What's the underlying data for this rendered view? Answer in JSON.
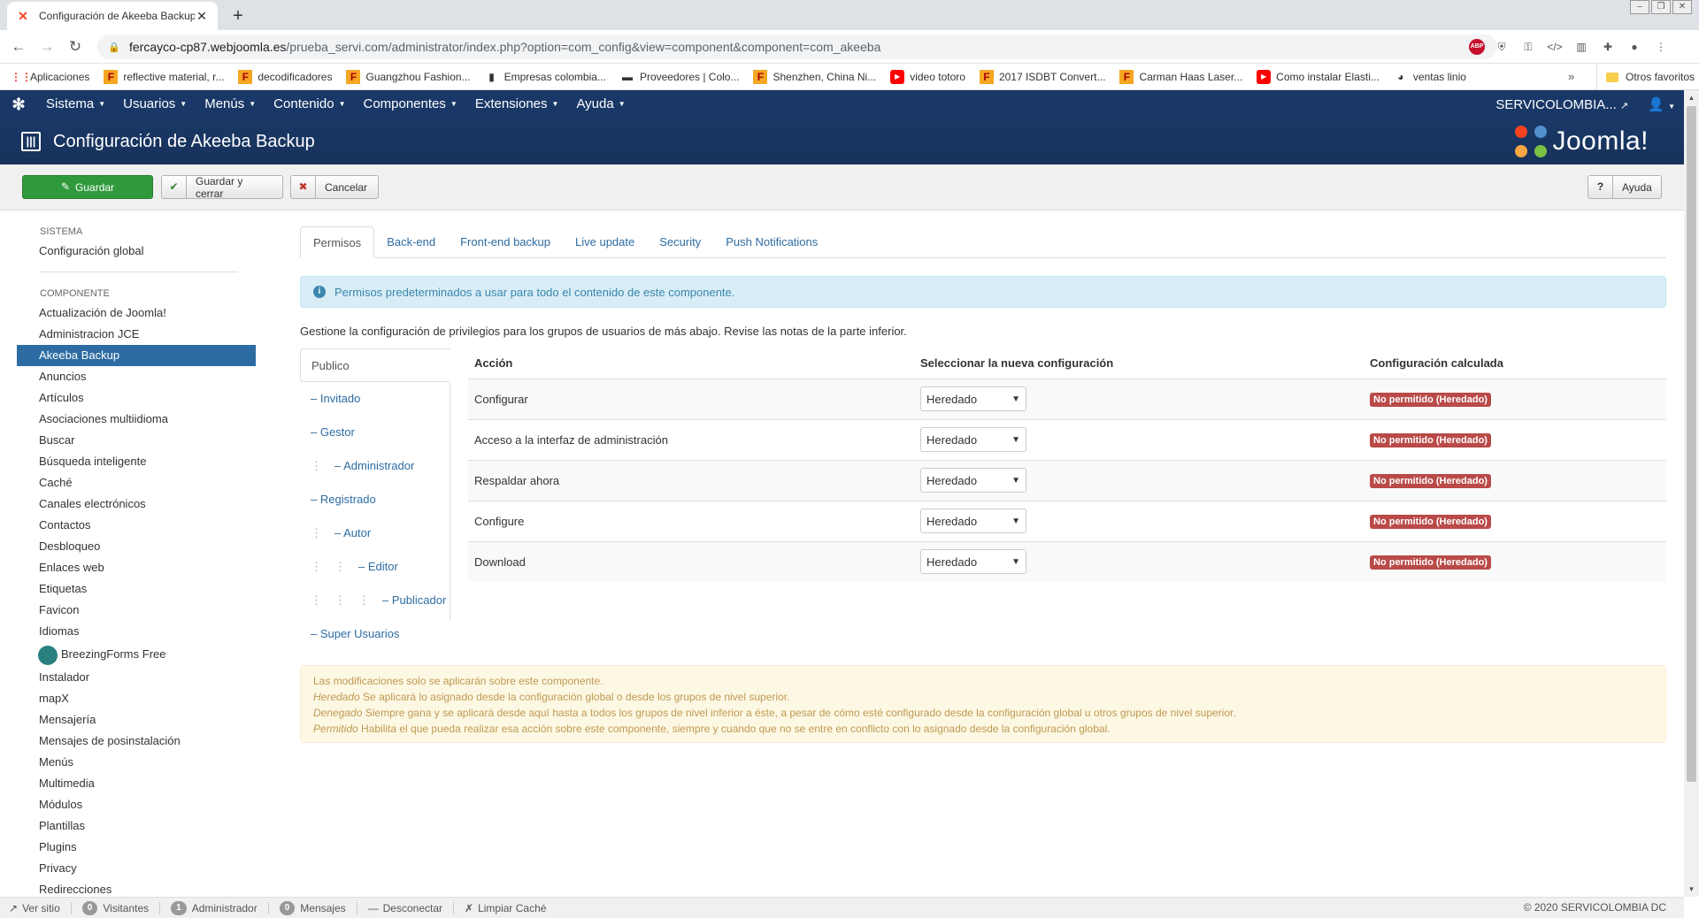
{
  "browser": {
    "tab_title": "Configuración de Akeeba Backup",
    "url_host": "fercayco-cp87.webjoomla.es",
    "url_path": "/prueba_servi.com/administrator/index.php?option=com_config&view=component&component=com_akeeba",
    "bookmarks": [
      {
        "icon": "apps-icon",
        "label": "Aplicaciones"
      },
      {
        "icon": "aliexpress-icon",
        "label": "reflective material, r..."
      },
      {
        "icon": "aliexpress-icon",
        "label": "decodificadores"
      },
      {
        "icon": "aliexpress-icon",
        "label": "Guangzhou Fashion..."
      },
      {
        "icon": "page-icon",
        "label": "Empresas colombia..."
      },
      {
        "icon": "truck-icon",
        "label": "Proveedores | Colo..."
      },
      {
        "icon": "aliexpress-icon",
        "label": "Shenzhen, China Ni..."
      },
      {
        "icon": "youtube-icon",
        "label": "video totoro"
      },
      {
        "icon": "aliexpress-icon",
        "label": "2017 ISDBT Convert..."
      },
      {
        "icon": "aliexpress-icon",
        "label": "Carman Haas Laser..."
      },
      {
        "icon": "youtube-icon",
        "label": "Como instalar Elasti..."
      },
      {
        "icon": "globe-icon",
        "label": "ventas linio"
      }
    ],
    "bookmarks_more": "»",
    "other_bookmarks": "Otros favoritos"
  },
  "navbar": {
    "menu": [
      "Sistema",
      "Usuarios",
      "Menús",
      "Contenido",
      "Componentes",
      "Extensiones",
      "Ayuda"
    ],
    "site_name": "SERVICOLOMBIA..."
  },
  "header": {
    "title": "Configuración de Akeeba Backup",
    "brand": "Joomla!"
  },
  "toolbar": {
    "save": "Guardar",
    "save_close": "Guardar y cerrar",
    "cancel": "Cancelar",
    "help": "Ayuda"
  },
  "sidebar": {
    "system_heading": "Sistema",
    "system_items": [
      "Configuración global"
    ],
    "component_heading": "Componente",
    "component_items": [
      "Actualización de Joomla!",
      "Administracion JCE",
      "Akeeba Backup",
      "Anuncios",
      "Artículos",
      "Asociaciones multiidioma",
      "Buscar",
      "Búsqueda inteligente",
      "Caché",
      "Canales electrónicos",
      "Contactos",
      "Desbloqueo",
      "Enlaces web",
      "Etiquetas",
      "Favicon",
      "Idiomas",
      "BreezingForms Free",
      "Instalador",
      "mapX",
      "Mensajería",
      "Mensajes de posinstalación",
      "Menús",
      "Multimedia",
      "Módulos",
      "Plantillas",
      "Plugins",
      "Privacy",
      "Redirecciones"
    ],
    "active_item": "Akeeba Backup"
  },
  "tabs": [
    "Permisos",
    "Back-end",
    "Front-end backup",
    "Live update",
    "Security",
    "Push Notifications"
  ],
  "info_message": "Permisos predeterminados a usar para todo el contenido de este componente.",
  "intro_text": "Gestione la configuración de privilegios para los grupos de usuarios de más abajo. Revise las notas de la parte inferior.",
  "groups": [
    {
      "label": "Publico",
      "depth": 0
    },
    {
      "label": "– Invitado",
      "depth": 0
    },
    {
      "label": "– Gestor",
      "depth": 0
    },
    {
      "label": "– Administrador",
      "depth": 1
    },
    {
      "label": "– Registrado",
      "depth": 0
    },
    {
      "label": "– Autor",
      "depth": 1
    },
    {
      "label": "– Editor",
      "depth": 2
    },
    {
      "label": "– Publicador",
      "depth": 3
    },
    {
      "label": "– Super Usuarios",
      "depth": 0
    }
  ],
  "permissions_table": {
    "headers": [
      "Acción",
      "Seleccionar la nueva configuración",
      "Configuración calculada"
    ],
    "rows": [
      {
        "action": "Configurar",
        "setting": "Heredado",
        "calculated": "No permitido (Heredado)"
      },
      {
        "action": "Acceso a la interfaz de administración",
        "setting": "Heredado",
        "calculated": "No permitido (Heredado)"
      },
      {
        "action": "Respaldar ahora",
        "setting": "Heredado",
        "calculated": "No permitido (Heredado)"
      },
      {
        "action": "Configure",
        "setting": "Heredado",
        "calculated": "No permitido (Heredado)"
      },
      {
        "action": "Download",
        "setting": "Heredado",
        "calculated": "No permitido (Heredado)"
      }
    ]
  },
  "notes": {
    "line1": "Las modificaciones solo se aplicarán sobre este componente.",
    "inherited_term": "Heredado",
    "inherited_text": " Se aplicará lo asignado desde la configuración global o desde los grupos de nivel superior.",
    "denied_term": "Denegado",
    "denied_text": " Siempre gana y se aplicará desde aquí hasta a todos los grupos de nivel inferior a éste, a pesar de cómo esté configurado desde la configuración global u otros grupos de nivel superior.",
    "allowed_term": "Permitido",
    "allowed_text": " Habilita el que pueda realizar esa acción sobre este componente, siempre y cuando que no se entre en conflicto con lo asignado desde la configuración global."
  },
  "statusbar": {
    "view_site": "Ver sitio",
    "visitors_count": "0",
    "visitors": "Visitantes",
    "admin_count": "1",
    "admin": "Administrador",
    "messages_count": "0",
    "messages": "Mensajes",
    "logout": "Desconectar",
    "clear_cache": "Limpiar Caché",
    "copyright": "© 2020 SERVICOLOMBIA DC"
  },
  "colors": {
    "navbar": "#1a3867",
    "save_button": "#2f9a3c",
    "sidebar_active": "#2d6ca2",
    "badge_denied": "#b94a48"
  }
}
